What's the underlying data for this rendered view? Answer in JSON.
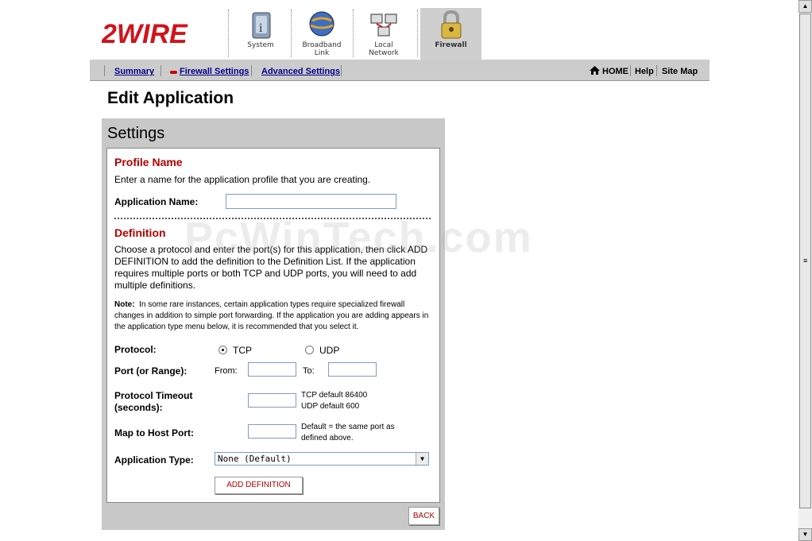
{
  "header": {
    "logo_text": "2WIRE",
    "tabs": [
      {
        "label": "System",
        "icon": "system-icon"
      },
      {
        "label": "Broadband Link",
        "icon": "globe-icon"
      },
      {
        "label": "Local Network",
        "icon": "network-icon"
      },
      {
        "label": "Firewall",
        "icon": "lock-icon",
        "active": true
      }
    ]
  },
  "subnav": {
    "links": [
      "Summary",
      "Firewall Settings",
      "Advanced Settings"
    ],
    "right_links": [
      "HOME",
      "Help",
      "Site Map"
    ]
  },
  "page_title": "Edit Application",
  "panel": {
    "title": "Settings",
    "profile_heading": "Profile Name",
    "profile_desc": "Enter a name for the application profile that you are creating.",
    "app_name_label": "Application Name:",
    "app_name_value": "",
    "definition_heading": "Definition",
    "definition_desc": "Choose a protocol and enter the port(s) for this application, then click ADD DEFINITION to add the definition to the Definition List. If the application requires multiple ports or both TCP and UDP ports, you will need to add multiple definitions.",
    "note_label": "Note:",
    "note_text": "In some rare instances, certain application types require specialized firewall changes in addition to simple port forwarding. If the application you are adding appears in the application type menu below, it is recommended that you select it.",
    "protocol_label": "Protocol:",
    "protocol_tcp": "TCP",
    "protocol_udp": "UDP",
    "protocol_selected": "TCP",
    "port_label": "Port (or Range):",
    "from_label": "From:",
    "to_label": "To:",
    "timeout_label": "Protocol Timeout (seconds):",
    "tcp_default": "TCP default 86400",
    "udp_default": "UDP default 600",
    "map_label": "Map to Host Port:",
    "map_hint": "Default = the same port as defined above.",
    "app_type_label": "Application Type:",
    "app_type_value": "None (Default)",
    "add_button": "ADD DEFINITION",
    "back_button": "BACK"
  },
  "watermark": "PcWinTech.com",
  "colors": {
    "accent_red": "#b30000",
    "subnav_bg": "#cccccc",
    "panel_bg": "#c8c8c8"
  }
}
